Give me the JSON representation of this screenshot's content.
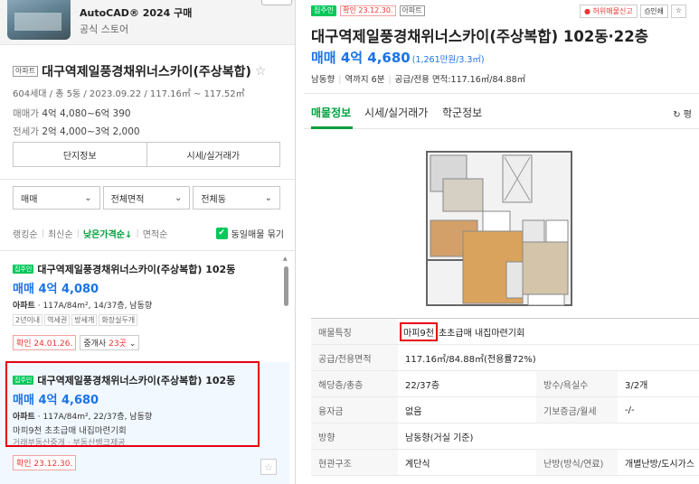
{
  "ad": {
    "title": "AutoCAD® 2024 구매",
    "subtitle": "공식 스토어"
  },
  "complex": {
    "tag": "아파트",
    "name": "대구역제일풍경채위너스카이(주상복합)",
    "info": "604세대 / 총 5동 / 2023.09.22 / 117.16㎡ ~ 117.52㎡",
    "sale_label": "매매가",
    "sale_value": "4억 4,080~6억 390",
    "lease_label": "전세가",
    "lease_value": "2억 4,000~3억 2,000",
    "btn_info": "단지정보",
    "btn_price": "시세/실거래가"
  },
  "filters": [
    "매매",
    "전체면적",
    "전체동"
  ],
  "sort": {
    "items": [
      "랭킹순",
      "최신순",
      "낮은가격순↓",
      "면적순"
    ],
    "active_index": 2,
    "same_listing": "동일매물 묶기"
  },
  "listings": [
    {
      "tag": "집주인",
      "name": "대구역제일풍경채위너스카이(주상복합) 102동",
      "price": "매매 4억 4,080",
      "type": "아파트",
      "spec": "117A/84m², 14/37층, 남동향",
      "chips": [
        "2년이내",
        "역세권",
        "방세개",
        "화장실두개"
      ],
      "confirm": "확인 24.01.26.",
      "broker_label": "중개사",
      "broker_count": "23곳"
    },
    {
      "tag": "집주인",
      "name": "대구역제일풍경채위너스카이(주상복합) 102동",
      "price": "매매 4억 4,680",
      "type": "아파트",
      "spec": "117A/84m², 22/37층, 남동향",
      "desc": "마피9천 초초급매 내집마련기회",
      "desc2": "거래부동산중개 · 부동산뱅크제공",
      "confirm": "확인 23.12.30."
    }
  ],
  "detail": {
    "tag": "집주인",
    "confirm": "확인 23.12.30.",
    "type": "아파트",
    "report": "허위매물신고",
    "print": "인쇄",
    "title": "대구역제일풍경채위너스카이(주상복합) 102동·22층",
    "price": "매매 4억 4,680",
    "unit_price": "(1,261만원/3.3㎡)",
    "spec": [
      "남동향",
      "역까지 6분",
      "공급/전용 면적:117.16㎡/84.88㎡"
    ],
    "tabs": [
      "매물정보",
      "시세/실거래가",
      "학군정보"
    ],
    "pyeong": "평",
    "rows": [
      {
        "k": "매물특징",
        "v_hl": "마피9천",
        "v": "초초급매 내집마련기회"
      },
      {
        "k": "공급/전용면적",
        "v": "117.16㎡/84.88㎡(전용률72%)"
      },
      {
        "k": "해당층/총층",
        "v": "22/37층",
        "k2": "방수/욕실수",
        "v2": "3/2개"
      },
      {
        "k": "융자금",
        "v": "없음",
        "k2": "기보증금/월세",
        "v2": "-/-"
      },
      {
        "k": "방향",
        "v": "남동향(거실 기준)"
      },
      {
        "k": "현관구조",
        "v": "계단식",
        "k2": "난방(방식/연료)",
        "v2": "개별난방/도시가스"
      }
    ]
  },
  "colors": {
    "accent_green": "#03c75a",
    "price_blue": "#1a73e8",
    "highlight_red": "#e60012"
  }
}
